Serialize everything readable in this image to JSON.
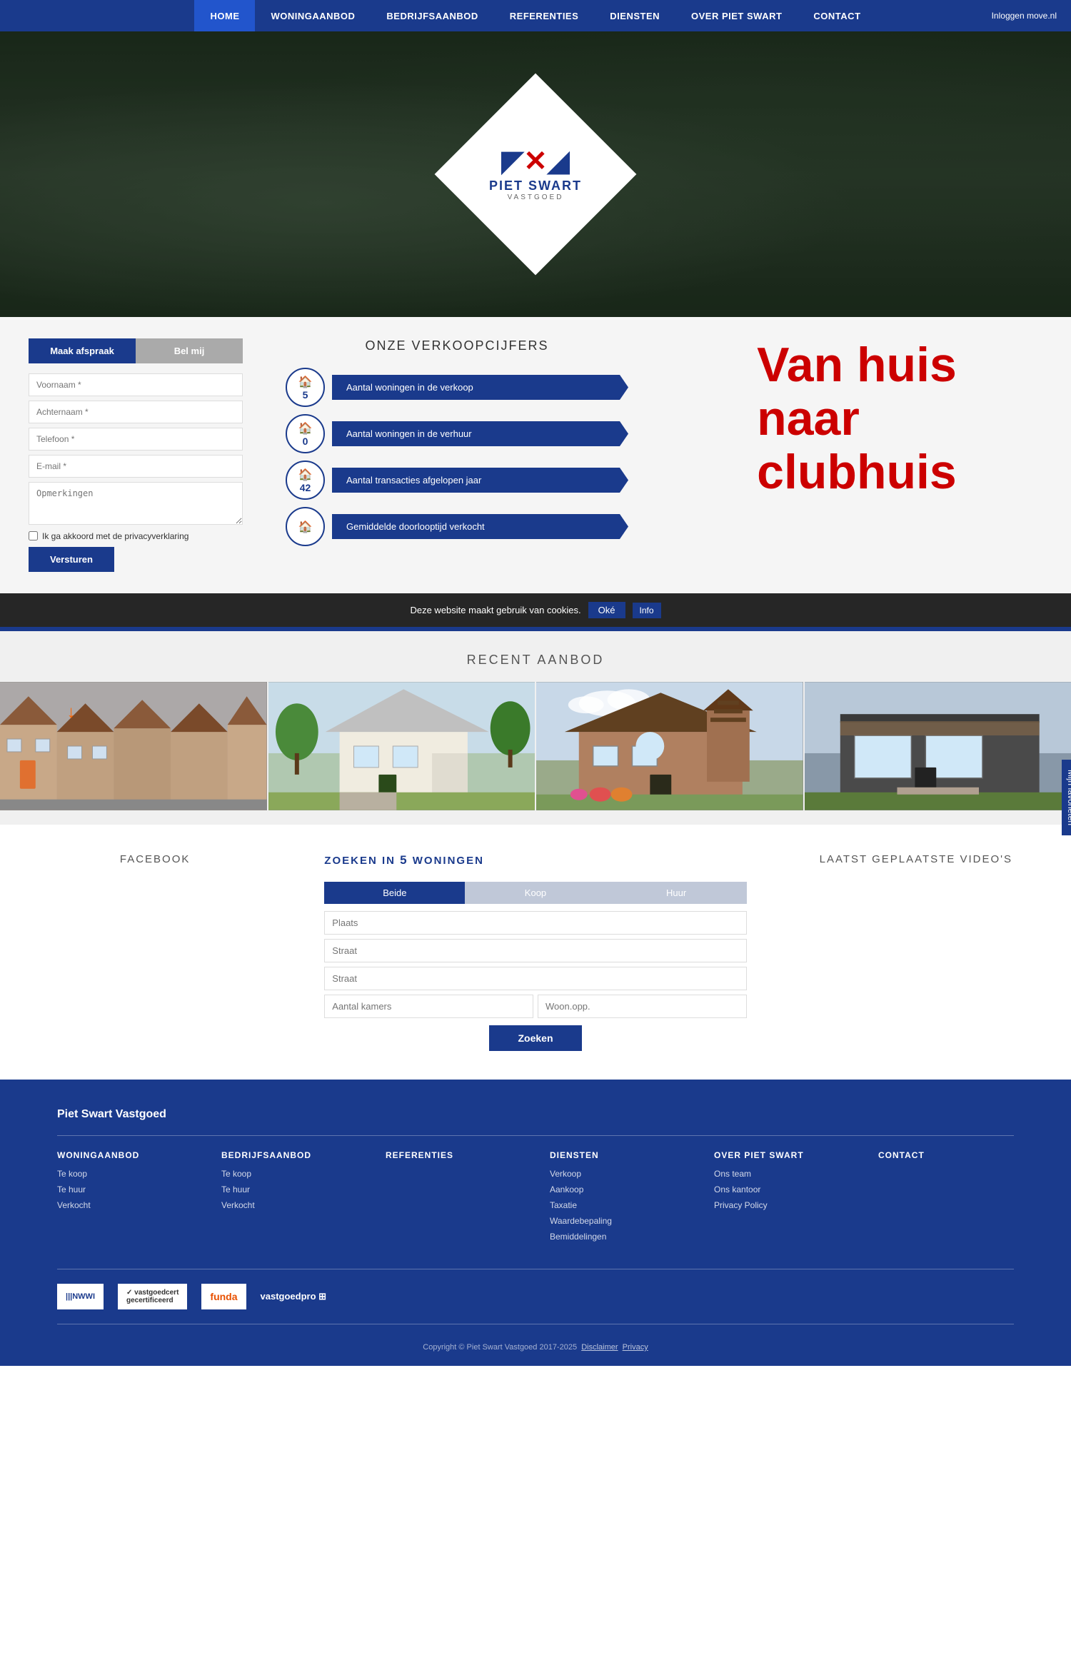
{
  "nav": {
    "items": [
      {
        "label": "HOME",
        "active": true
      },
      {
        "label": "WONINGAANBOD",
        "active": false
      },
      {
        "label": "BEDRIJFSAANBOD",
        "active": false
      },
      {
        "label": "REFERENTIES",
        "active": false
      },
      {
        "label": "DIENSTEN",
        "active": false
      },
      {
        "label": "OVER PIET SWART",
        "active": false
      },
      {
        "label": "CONTACT",
        "active": false
      }
    ],
    "login": "Inloggen move.nl"
  },
  "sidebar": {
    "favorites_label": "Mijn favorieten"
  },
  "logo": {
    "brand": "PIET SWART",
    "sub": "VASTGOED"
  },
  "form": {
    "tab_afspraak": "Maak afspraak",
    "tab_bel": "Bel mij",
    "voornaam": "Voornaam *",
    "achternaam": "Achternaam *",
    "telefoon": "Telefoon *",
    "email": "E-mail *",
    "opmerkingen": "Opmerkingen",
    "checkbox_label": "Ik ga akkoord met de privacyverklaring",
    "submit": "Versturen"
  },
  "verkoopcijfers": {
    "title": "ONZE VERKOOPCIJFERS",
    "stats": [
      {
        "number": "5",
        "label": "Aantal woningen in de verkoop"
      },
      {
        "number": "0",
        "label": "Aantal woningen in de verhuur"
      },
      {
        "number": "42",
        "label": "Aantal transacties afgelopen jaar"
      },
      {
        "number": "",
        "label": "Gemiddelde doorlooptijd verkocht"
      }
    ]
  },
  "promo": {
    "line1": "Van huis",
    "line2": "naar",
    "line3": "clubhuis"
  },
  "cookie": {
    "text": "Deze website maakt gebruik van cookies.",
    "ok": "Oké",
    "info": "Info"
  },
  "recent": {
    "title": "RECENT AANBOD"
  },
  "search": {
    "title_prefix": "ZOEKEN IN ",
    "count": "5",
    "title_suffix": " WONINGEN",
    "tabs": [
      "Beide",
      "Koop",
      "Huur"
    ],
    "active_tab": "Beide",
    "plaats_placeholder": "Plaats",
    "straat_placeholder": "Straat",
    "straat2_placeholder": "Straat",
    "kamers_placeholder": "Aantal kamers",
    "woon_placeholder": "Woon.opp.",
    "button": "Zoeken"
  },
  "facebook": {
    "title": "FACEBOOK"
  },
  "videos": {
    "title": "LAATST GEPLAATSTE VIDEO'S"
  },
  "footer": {
    "brand": "Piet Swart Vastgoed",
    "cols": [
      {
        "title": "WONINGAANBOD",
        "links": [
          "Te koop",
          "Te huur",
          "Verkocht"
        ]
      },
      {
        "title": "BEDRIJFSAANBOD",
        "links": [
          "Te koop",
          "Te huur",
          "Verkocht"
        ]
      },
      {
        "title": "REFERENTIES",
        "links": []
      },
      {
        "title": "DIENSTEN",
        "links": [
          "Verkoop",
          "Aankoop",
          "Taxatie",
          "Waardebepaling",
          "Bemiddelingen"
        ]
      },
      {
        "title": "OVER PIET SWART",
        "links": [
          "Ons team",
          "Ons kantoor",
          "Privacy Policy"
        ]
      },
      {
        "title": "CONTACT",
        "links": []
      }
    ],
    "copyright": "Copyright © Piet Swart Vastgoed 2017-2025",
    "disclaimer": "Disclaimer",
    "privacy": "Privacy"
  }
}
